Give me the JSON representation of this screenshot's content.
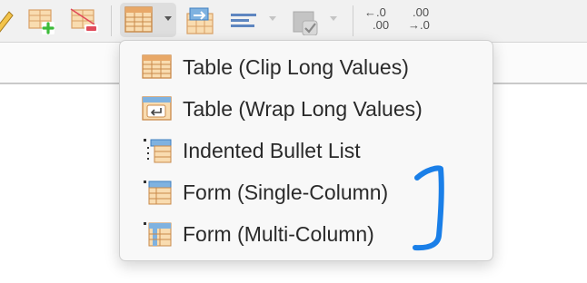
{
  "toolbar": {
    "icons": [
      "pencil-icon",
      "add-row-icon",
      "delete-row-icon",
      "table-layout-icon",
      "export-icon",
      "align-left-icon",
      "fill-color-icon",
      "increase-decimal-icon",
      "decrease-decimal-icon"
    ],
    "increase_decimal": {
      "top": "←.0",
      "bottom": ".00"
    },
    "decrease_decimal": {
      "top": ".00",
      "bottom": "→.0"
    }
  },
  "layout_menu": {
    "items": [
      {
        "label": "Table (Clip Long Values)",
        "icon": "table-clip-icon"
      },
      {
        "label": "Table (Wrap Long Values)",
        "icon": "table-wrap-icon"
      },
      {
        "label": "Indented Bullet List",
        "icon": "indented-list-icon"
      },
      {
        "label": "Form (Single-Column)",
        "icon": "form-single-column-icon"
      },
      {
        "label": "Form (Multi-Column)",
        "icon": "form-multi-column-icon"
      }
    ]
  },
  "colors": {
    "table_fill": "#f9dcb0",
    "table_stroke": "#d9a066",
    "table_header": "#7fb2e0",
    "add_green": "#3dbb3a",
    "remove_red": "#e04a5a",
    "annotation_blue": "#1a7fe8"
  }
}
